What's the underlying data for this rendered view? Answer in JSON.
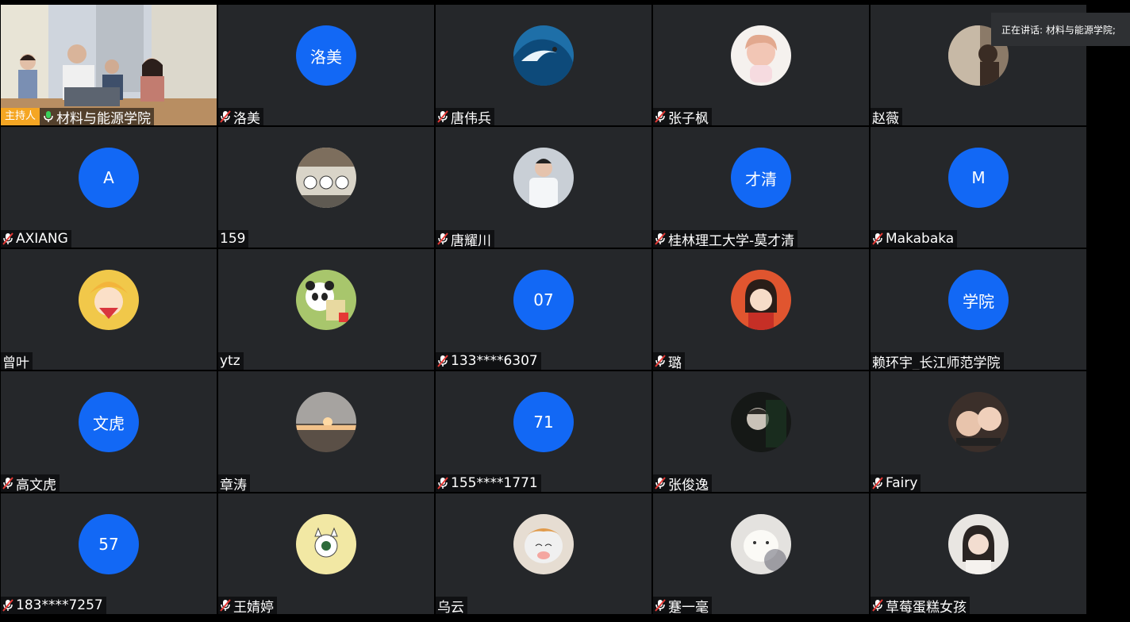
{
  "speaking": {
    "label": "正在讲话: 材料与能源学院;"
  },
  "host_badge": "主持人",
  "colors": {
    "tile_bg": "#25272a",
    "avatar_blue": "#1268f5",
    "host_badge": "#f5a623",
    "page_bg": "#000000"
  },
  "participants": [
    {
      "name": "材料与能源学院",
      "avatar": null,
      "avatar_kind": "video",
      "mic": "active",
      "host": true
    },
    {
      "name": "洛美",
      "avatar": "洛美",
      "avatar_kind": "text",
      "mic": "muted"
    },
    {
      "name": "唐伟兵",
      "avatar": null,
      "avatar_kind": "photo",
      "photo": "wave",
      "mic": "muted"
    },
    {
      "name": "张子枫",
      "avatar": null,
      "avatar_kind": "photo",
      "photo": "anime-girl",
      "mic": "muted"
    },
    {
      "name": "赵薇",
      "avatar": null,
      "avatar_kind": "photo",
      "photo": "room",
      "mic": "none"
    },
    {
      "name": "AXIANG",
      "avatar": "A",
      "avatar_kind": "text",
      "mic": "muted"
    },
    {
      "name": "159",
      "avatar": null,
      "avatar_kind": "photo",
      "photo": "cartoon-wall",
      "mic": "none"
    },
    {
      "name": "唐耀川",
      "avatar": null,
      "avatar_kind": "photo",
      "photo": "person-white",
      "mic": "muted"
    },
    {
      "name": "桂林理工大学-莫才清",
      "avatar": "才清",
      "avatar_kind": "text",
      "mic": "muted"
    },
    {
      "name": "Makabaka",
      "avatar": "M",
      "avatar_kind": "text",
      "mic": "muted"
    },
    {
      "name": "曾叶",
      "avatar": null,
      "avatar_kind": "photo",
      "photo": "sailor-moon",
      "mic": "none"
    },
    {
      "name": "ytz",
      "avatar": null,
      "avatar_kind": "photo",
      "photo": "panda",
      "mic": "none"
    },
    {
      "name": "133****6307",
      "avatar": "07",
      "avatar_kind": "text",
      "mic": "muted"
    },
    {
      "name": "璐",
      "avatar": null,
      "avatar_kind": "photo",
      "photo": "cartoon-girl-red",
      "mic": "muted"
    },
    {
      "name": "赖环宇_长江师范学院",
      "avatar": "学院",
      "avatar_kind": "text",
      "mic": "none"
    },
    {
      "name": "高文虎",
      "avatar": "文虎",
      "avatar_kind": "text",
      "mic": "muted"
    },
    {
      "name": "章涛",
      "avatar": null,
      "avatar_kind": "photo",
      "photo": "sunset",
      "mic": "none"
    },
    {
      "name": "155****1771",
      "avatar": "71",
      "avatar_kind": "text",
      "mic": "muted"
    },
    {
      "name": "张俊逸",
      "avatar": null,
      "avatar_kind": "photo",
      "photo": "dark-portrait",
      "mic": "muted"
    },
    {
      "name": "Fairy",
      "avatar": null,
      "avatar_kind": "photo",
      "photo": "two-babies",
      "mic": "muted"
    },
    {
      "name": "183****7257",
      "avatar": "57",
      "avatar_kind": "text",
      "mic": "muted"
    },
    {
      "name": "王婧婷",
      "avatar": null,
      "avatar_kind": "photo",
      "photo": "cat-yellow",
      "mic": "muted"
    },
    {
      "name": "乌云",
      "avatar": null,
      "avatar_kind": "photo",
      "photo": "cat-face",
      "mic": "none"
    },
    {
      "name": "蹇一毫",
      "avatar": null,
      "avatar_kind": "photo",
      "photo": "plush-sheep",
      "mic": "muted"
    },
    {
      "name": "草莓蛋糕女孩",
      "avatar": null,
      "avatar_kind": "photo",
      "photo": "girl-portrait",
      "mic": "muted"
    }
  ]
}
